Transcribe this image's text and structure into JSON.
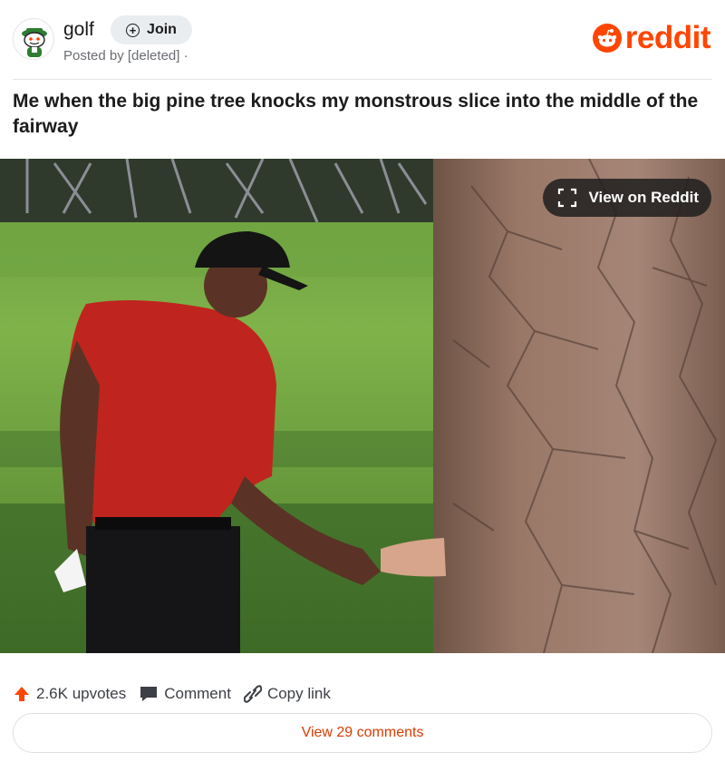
{
  "header": {
    "subreddit": "golf",
    "join_label": "Join",
    "posted_by": "Posted by [deleted] ·",
    "brand": "reddit"
  },
  "post": {
    "title": "Me when the big pine tree knocks my monstrous slice into the middle of the fairway"
  },
  "media": {
    "view_button_label": "View on Reddit"
  },
  "actions": {
    "upvotes": "2.6K upvotes",
    "comment": "Comment",
    "copy_link": "Copy link"
  },
  "footer": {
    "view_comments": "View 29 comments"
  },
  "colors": {
    "brand": "#ff4500",
    "comments_link": "#d93a00"
  },
  "icons": [
    "snoo-golf-avatar",
    "plus-circle-icon",
    "reddit-logo-icon",
    "expand-icon",
    "upvote-arrow-icon",
    "comment-bubble-icon",
    "link-icon"
  ]
}
